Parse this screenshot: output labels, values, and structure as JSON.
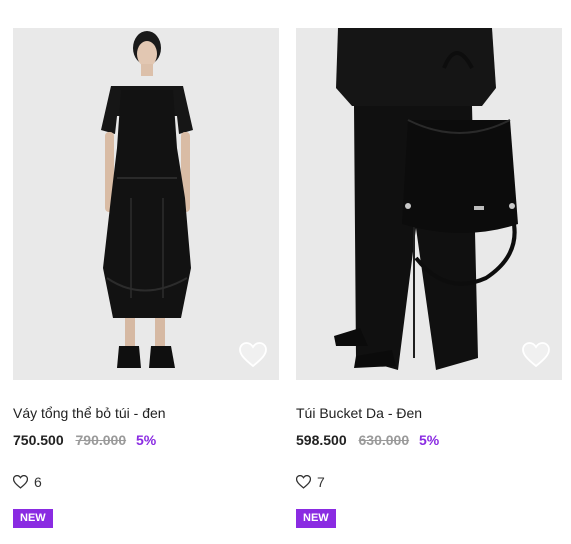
{
  "products": [
    {
      "name": "Váy tổng thể bỏ túi - đen",
      "price": "750.500",
      "old_price": "790.000",
      "discount": "5%",
      "likes": "6",
      "badge": "NEW",
      "wishlist_icon": "heart-outline-icon",
      "like_icon": "heart-outline-icon"
    },
    {
      "name": "Túi Bucket Da - Đen",
      "price": "598.500",
      "old_price": "630.000",
      "discount": "5%",
      "likes": "7",
      "badge": "NEW",
      "wishlist_icon": "heart-outline-icon",
      "like_icon": "heart-outline-icon"
    }
  ],
  "colors": {
    "accent": "#8a2be2",
    "photo_bg": "#ebebeb",
    "old_price": "#9a9a9a"
  }
}
